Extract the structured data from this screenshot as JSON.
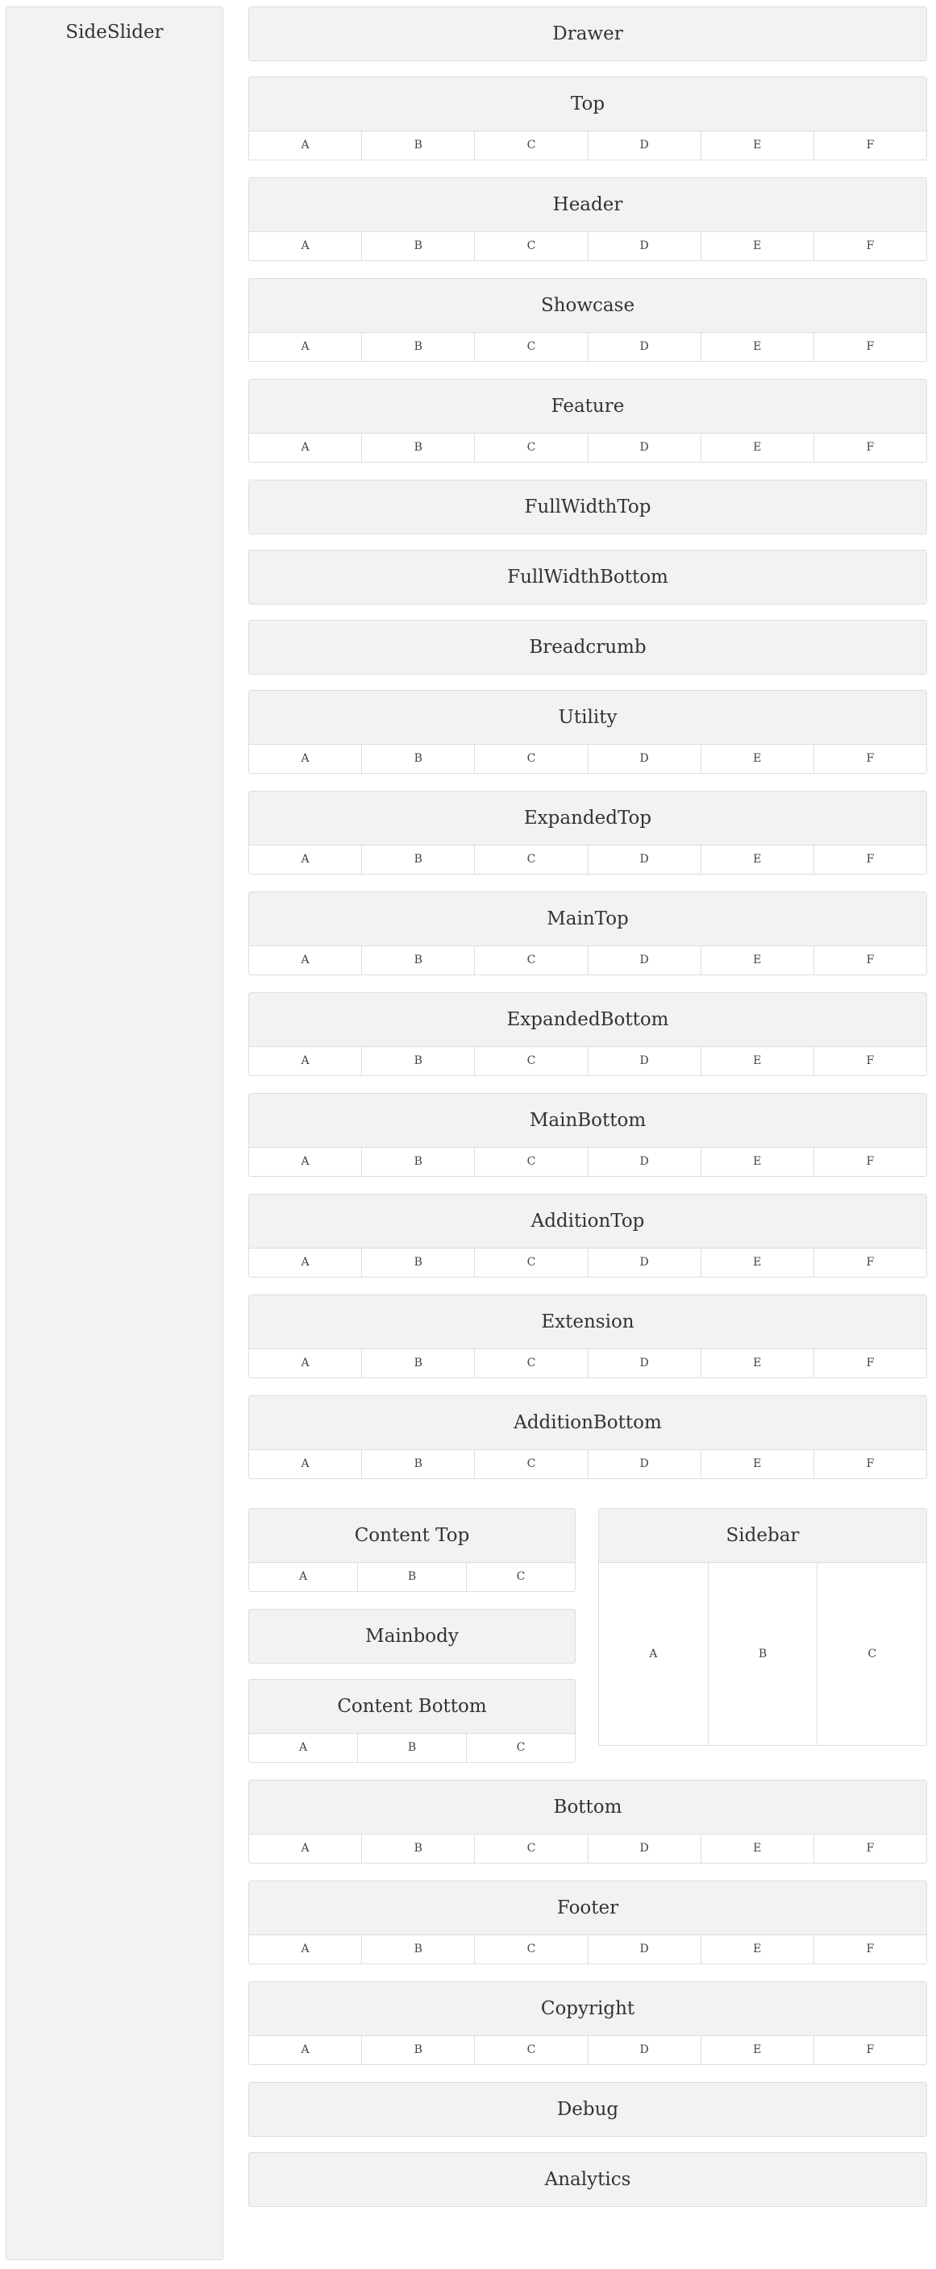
{
  "sideslider": {
    "title": "SideSlider"
  },
  "sections_top": [
    {
      "id": "drawer",
      "title": "Drawer",
      "cells": []
    },
    {
      "id": "top",
      "title": "Top",
      "cells": [
        "A",
        "B",
        "C",
        "D",
        "E",
        "F"
      ]
    },
    {
      "id": "header",
      "title": "Header",
      "cells": [
        "A",
        "B",
        "C",
        "D",
        "E",
        "F"
      ]
    },
    {
      "id": "showcase",
      "title": "Showcase",
      "cells": [
        "A",
        "B",
        "C",
        "D",
        "E",
        "F"
      ]
    },
    {
      "id": "feature",
      "title": "Feature",
      "cells": [
        "A",
        "B",
        "C",
        "D",
        "E",
        "F"
      ]
    },
    {
      "id": "fullwidthtop",
      "title": "FullWidthTop",
      "cells": []
    },
    {
      "id": "fullwidthbottom",
      "title": "FullWidthBottom",
      "cells": []
    },
    {
      "id": "breadcrumb",
      "title": "Breadcrumb",
      "cells": []
    },
    {
      "id": "utility",
      "title": "Utility",
      "cells": [
        "A",
        "B",
        "C",
        "D",
        "E",
        "F"
      ]
    },
    {
      "id": "expandedtop",
      "title": "ExpandedTop",
      "cells": [
        "A",
        "B",
        "C",
        "D",
        "E",
        "F"
      ]
    },
    {
      "id": "maintop",
      "title": "MainTop",
      "cells": [
        "A",
        "B",
        "C",
        "D",
        "E",
        "F"
      ]
    },
    {
      "id": "expandedbottom",
      "title": "ExpandedBottom",
      "cells": [
        "A",
        "B",
        "C",
        "D",
        "E",
        "F"
      ]
    },
    {
      "id": "mainbottom",
      "title": "MainBottom",
      "cells": [
        "A",
        "B",
        "C",
        "D",
        "E",
        "F"
      ]
    },
    {
      "id": "additiontop",
      "title": "AdditionTop",
      "cells": [
        "A",
        "B",
        "C",
        "D",
        "E",
        "F"
      ]
    },
    {
      "id": "extension",
      "title": "Extension",
      "cells": [
        "A",
        "B",
        "C",
        "D",
        "E",
        "F"
      ]
    },
    {
      "id": "additionbottom",
      "title": "AdditionBottom",
      "cells": [
        "A",
        "B",
        "C",
        "D",
        "E",
        "F"
      ]
    }
  ],
  "content": {
    "left": [
      {
        "id": "content-top",
        "title": "Content Top",
        "cells": [
          "A",
          "B",
          "C"
        ]
      },
      {
        "id": "mainbody",
        "title": "Mainbody",
        "cells": []
      },
      {
        "id": "content-bottom",
        "title": "Content Bottom",
        "cells": [
          "A",
          "B",
          "C"
        ]
      }
    ],
    "sidebar": {
      "id": "sidebar",
      "title": "Sidebar",
      "cells": [
        "A",
        "B",
        "C"
      ]
    }
  },
  "sections_bottom": [
    {
      "id": "bottom",
      "title": "Bottom",
      "cells": [
        "A",
        "B",
        "C",
        "D",
        "E",
        "F"
      ]
    },
    {
      "id": "footer",
      "title": "Footer",
      "cells": [
        "A",
        "B",
        "C",
        "D",
        "E",
        "F"
      ]
    },
    {
      "id": "copyright",
      "title": "Copyright",
      "cells": [
        "A",
        "B",
        "C",
        "D",
        "E",
        "F"
      ]
    },
    {
      "id": "debug",
      "title": "Debug",
      "cells": []
    },
    {
      "id": "analytics",
      "title": "Analytics",
      "cells": []
    }
  ]
}
